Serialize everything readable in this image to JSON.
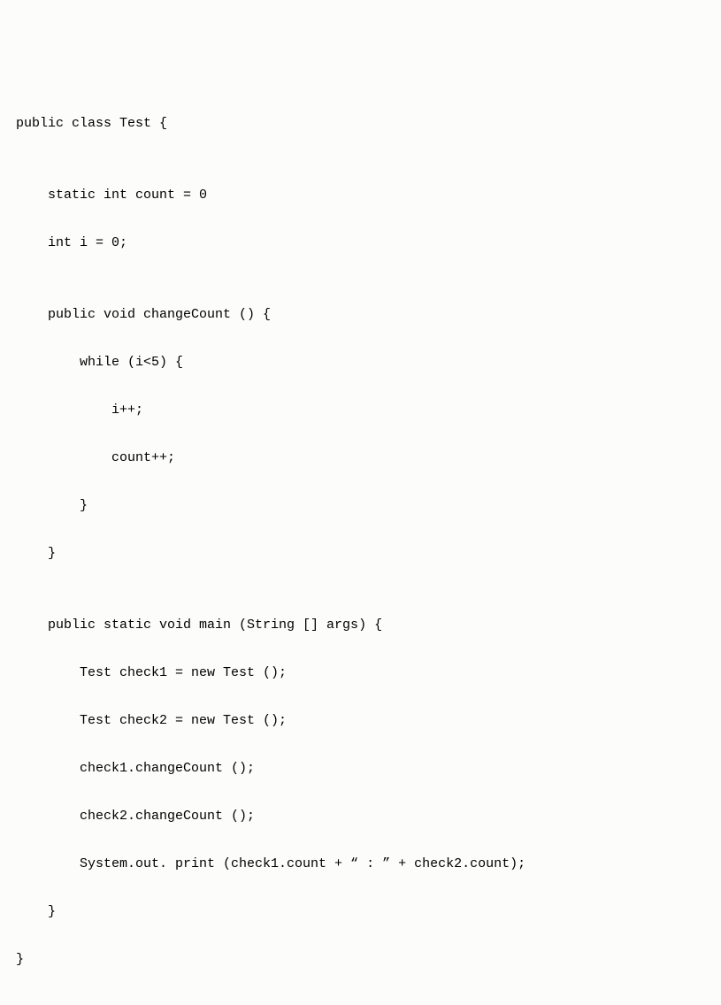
{
  "code": {
    "lines": [
      "public class Test {",
      "",
      "    static int count = 0",
      "    int i = 0;",
      "",
      "    public void changeCount () {",
      "        while (i<5) {",
      "            i++;",
      "            count++;",
      "        }",
      "    }",
      "",
      "    public static void main (String [] args) {",
      "        Test check1 = new Test ();",
      "        Test check2 = new Test ();",
      "        check1.changeCount ();",
      "        check2.changeCount ();",
      "        System.out. print (check1.count + “ : ” + check2.count);",
      "    }",
      "}"
    ]
  }
}
